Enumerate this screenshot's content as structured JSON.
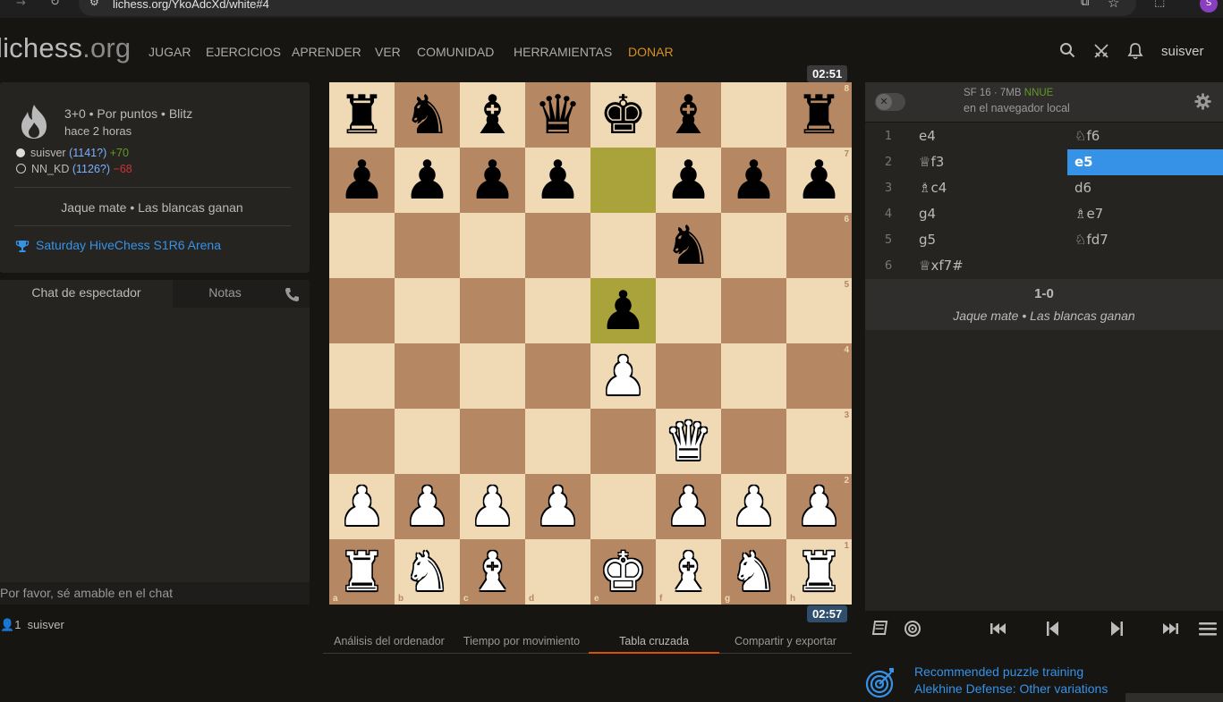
{
  "browser": {
    "url": "lichess.org/YkoAdcXd/white#4",
    "profile_initial": "S"
  },
  "header": {
    "logo_main": "lichess",
    "logo_tld": ".org",
    "nav": [
      "JUGAR",
      "EJERCICIOS",
      "APRENDER",
      "VER",
      "COMUNIDAD",
      "HERRAMIENTAS",
      "DONAR"
    ],
    "username": "suisver"
  },
  "game": {
    "setup": "3+0 • Por puntos • Blitz",
    "time_ago": "hace 2 horas",
    "white": {
      "name": "suisver",
      "rating": "(1141?)",
      "diff": "+70"
    },
    "black": {
      "name": "NN_KD",
      "rating": "(1126?)",
      "diff": "−68"
    },
    "result": "Jaque mate • Las blancas ganan",
    "tournament": "Saturday HiveChess S1R6 Arena"
  },
  "chat": {
    "tab_chat": "Chat de espectador",
    "tab_notes": "Notas",
    "placeholder": "Por favor, sé amable en el chat",
    "spectator_count": "1",
    "spectator_name": "suisver"
  },
  "board": {
    "ranks": [
      [
        "bR",
        "bN",
        "bB",
        "bQ",
        "bK",
        "bB",
        "",
        "bR"
      ],
      [
        "bP",
        "bP",
        "bP",
        "bP",
        "",
        "bP",
        "bP",
        "bP"
      ],
      [
        "",
        "",
        "",
        "",
        "",
        "bN",
        "",
        ""
      ],
      [
        "",
        "",
        "",
        "",
        "bP",
        "",
        "",
        ""
      ],
      [
        "",
        "",
        "",
        "",
        "wP",
        "",
        "",
        ""
      ],
      [
        "",
        "",
        "",
        "",
        "",
        "wQ",
        "",
        ""
      ],
      [
        "wP",
        "wP",
        "wP",
        "wP",
        "",
        "wP",
        "wP",
        "wP"
      ],
      [
        "wR",
        "wN",
        "wB",
        "",
        "wK",
        "wB",
        "wN",
        "wR"
      ]
    ],
    "highlight": [
      "e7",
      "e5"
    ],
    "rank_labels": [
      "8",
      "7",
      "6",
      "5",
      "4",
      "3",
      "2",
      "1"
    ],
    "file_labels": [
      "a",
      "b",
      "c",
      "d",
      "e",
      "f",
      "g",
      "h"
    ]
  },
  "clocks": {
    "top": "02:51",
    "bottom": "02:57"
  },
  "under_tabs": [
    "Análisis del ordenador",
    "Tiempo por movimiento",
    "Tabla cruzada",
    "Compartir y exportar"
  ],
  "engine": {
    "name": "SF 16 · 7MB",
    "nnue": "NNUE",
    "where": "en el navegador local"
  },
  "moves": [
    {
      "n": "1",
      "w": "e4",
      "b": "♘f6"
    },
    {
      "n": "2",
      "w": "♕f3",
      "b": "e5"
    },
    {
      "n": "3",
      "w": "♗c4",
      "b": "d6"
    },
    {
      "n": "4",
      "w": "g4",
      "b": "♗e7"
    },
    {
      "n": "5",
      "w": "g5",
      "b": "♘fd7"
    },
    {
      "n": "6",
      "w": "♕xf7#",
      "b": ""
    }
  ],
  "active_move": "2b",
  "result_panel": {
    "score": "1-0",
    "desc": "Jaque mate • Las blancas ganan"
  },
  "puzzle": {
    "title": "Recommended puzzle training",
    "subtitle": "Alekhine Defense: Other variations"
  },
  "colors": {
    "light": "#f0d9b5",
    "dark": "#b58863",
    "highlight": "#aaa23a",
    "accent": "#3692e7",
    "donate": "#d59120"
  }
}
